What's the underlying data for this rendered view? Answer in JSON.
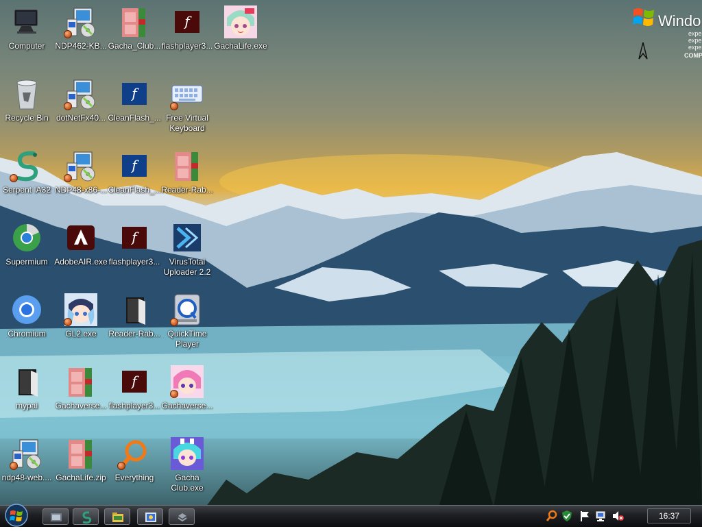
{
  "brand": {
    "word": "Windo",
    "lines": [
      "expe",
      "expe",
      "expe"
    ],
    "footer": "COMP"
  },
  "desktop": {
    "icons": [
      {
        "label": "Computer",
        "icon": "computer-icon"
      },
      {
        "label": "NDP462-KB...",
        "icon": "installer-icon"
      },
      {
        "label": "Gacha_Club...",
        "icon": "archive-icon"
      },
      {
        "label": "flashplayer3...",
        "icon": "flash-player-icon"
      },
      {
        "label": "GachaLife.exe",
        "icon": "gacha-life-icon"
      },
      {
        "label": "Recycle Bin",
        "icon": "recycle-bin-icon"
      },
      {
        "label": "dotNetFx40...",
        "icon": "installer-icon"
      },
      {
        "label": "CleanFlash_...",
        "icon": "flash-icon"
      },
      {
        "label": "Free Virtual Keyboard",
        "icon": "keyboard-icon"
      },
      {
        "label": "Serpent IA32",
        "icon": "serpent-icon"
      },
      {
        "label": "NDP48-x86-...",
        "icon": "installer-icon"
      },
      {
        "label": "CleanFlash_...",
        "icon": "flash-icon"
      },
      {
        "label": "Reader-Rab...",
        "icon": "archive-icon"
      },
      {
        "label": "Supermium",
        "icon": "supermium-icon"
      },
      {
        "label": "AdobeAIR.exe",
        "icon": "adobe-air-icon"
      },
      {
        "label": "flashplayer3...",
        "icon": "flash-player-icon"
      },
      {
        "label": "VirusTotal Uploader 2.2",
        "icon": "virustotal-icon"
      },
      {
        "label": "Chromium",
        "icon": "chromium-icon"
      },
      {
        "label": "GL2.exe",
        "icon": "gacha-character-icon"
      },
      {
        "label": "Reader-Rab...",
        "icon": "folder-icon"
      },
      {
        "label": "QuickTime Player",
        "icon": "quicktime-icon"
      },
      {
        "label": "mypai",
        "icon": "folder-icon"
      },
      {
        "label": "Gachaverse...",
        "icon": "archive-icon"
      },
      {
        "label": "flashplayer3...",
        "icon": "flash-player-icon"
      },
      {
        "label": "Gachaverse...",
        "icon": "gacha-character-pink-icon"
      },
      {
        "label": "ndp48-web....",
        "icon": "installer-icon"
      },
      {
        "label": "GachaLife.zip",
        "icon": "archive-icon"
      },
      {
        "label": "Everything",
        "icon": "everything-search-icon"
      },
      {
        "label": "Gacha Club.exe",
        "icon": "gacha-club-icon"
      }
    ]
  },
  "taskbar": {
    "start_label": "Start",
    "pinned": [
      {
        "name": "taskbar-explorer",
        "icon": "explorer-icon"
      },
      {
        "name": "taskbar-serpent",
        "icon": "serpent-icon"
      },
      {
        "name": "taskbar-folder",
        "icon": "folder-icon"
      },
      {
        "name": "taskbar-media",
        "icon": "media-icon"
      },
      {
        "name": "taskbar-app",
        "icon": "app-icon"
      }
    ],
    "tray": [
      "everything-icon",
      "security-icon",
      "action-center-flag-icon",
      "network-icon",
      "volume-muted-icon"
    ],
    "clock": "16:37"
  },
  "colors": {
    "taskbar": "#1d1f22",
    "label_text": "#ffffff",
    "flash_red": "#4a0a0a"
  }
}
